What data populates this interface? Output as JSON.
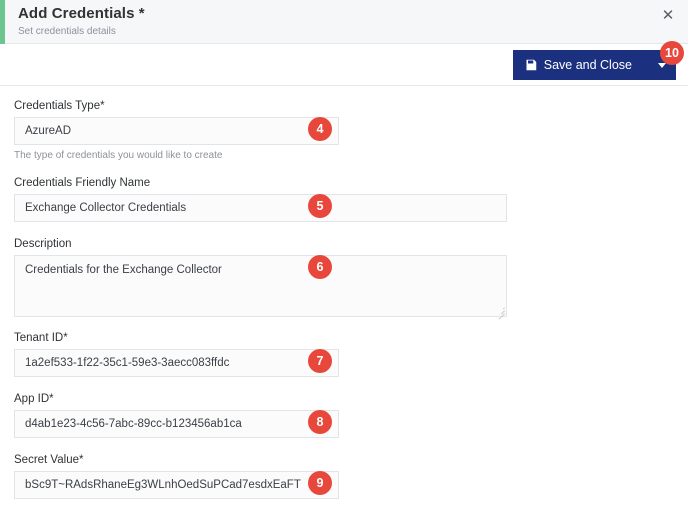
{
  "header": {
    "title": "Add Credentials *",
    "subtitle": "Set credentials details",
    "close_icon": "close-icon",
    "accent_color": "#6cc48f"
  },
  "toolbar": {
    "save_label": "Save and Close",
    "save_icon": "save-floppy-icon",
    "dropdown_icon": "caret-down-icon",
    "button_color": "#1c3080",
    "badge": "10"
  },
  "badge_color": "#e8473c",
  "form": {
    "credentials_type": {
      "label": "Credentials Type*",
      "value": "AzureAD",
      "helper": "The type of credentials you would like to create",
      "chevron_icon": "chevron-down-icon",
      "badge": "4"
    },
    "friendly_name": {
      "label": "Credentials Friendly Name",
      "value": "Exchange Collector Credentials",
      "badge": "5"
    },
    "description": {
      "label": "Description",
      "value": "Credentials for the Exchange Collector",
      "badge": "6"
    },
    "tenant_id": {
      "label": "Tenant ID*",
      "value": "1a2ef533-1f22-35c1-59e3-3aecc083ffdc",
      "badge": "7"
    },
    "app_id": {
      "label": "App ID*",
      "value": "d4ab1e23-4c56-7abc-89cc-b123456ab1ca",
      "badge": "8"
    },
    "secret_value": {
      "label": "Secret Value*",
      "value": "bSc9T~RAdsRhaneEg3WLnhOedSuPCad7esdxEaFT",
      "badge": "9"
    }
  }
}
